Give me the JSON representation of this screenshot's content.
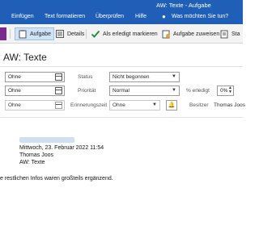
{
  "window": {
    "title": "AW: Texte  -  Aufgabe"
  },
  "tabs": [
    "Einfügen",
    "Text formatieren",
    "Überprüfen",
    "Hilfe"
  ],
  "tellme": {
    "placeholder": "Was möchten Sie tun?"
  },
  "toolbar": {
    "task_label": "Aufgabe",
    "details_label": "Details",
    "mark_done_label": "Als erledigt markieren",
    "assign_label": "Aufgabe zuweisen",
    "status_report_label": "Sta"
  },
  "task": {
    "subject": "AW: Texte",
    "start_date": "Ohne",
    "due_date": "Ohne",
    "reminder_date": "Ohne",
    "reminder_time": "Ohne",
    "status_label": "Status",
    "status_value": "Nicht begonnen",
    "priority_label": "Priorität",
    "priority_value": "Normal",
    "percent_label": "% erledigt",
    "percent_value": "0%",
    "reminder_label": "Erinnerungszeit",
    "owner_label": "Besitzer",
    "owner_value": "Thomas Joos"
  },
  "message": {
    "date_line": "Mittwoch, 23. Februar 2022 11:54",
    "sender": "Thomas Joos",
    "subject_line": "AW: Texte",
    "body": "e restlichen Infos waren großteils ergänzend."
  },
  "colors": {
    "titlebar": "#1f5fb8",
    "toolbar_bg": "#f3f3f3",
    "active_button": "#cfe2f8",
    "done_check": "#1a8a3c"
  }
}
